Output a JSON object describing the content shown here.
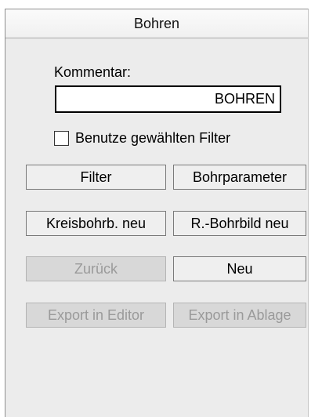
{
  "panel": {
    "title": "Bohren"
  },
  "comment": {
    "label": "Kommentar:",
    "value": "BOHREN"
  },
  "filter_option": {
    "label": "Benutze gewählten Filter",
    "checked": false
  },
  "buttons": {
    "filter": {
      "label": "Filter",
      "enabled": true
    },
    "drill_parameters": {
      "label": "Bohrparameter",
      "enabled": true
    },
    "new_circular_drill": {
      "label": "Kreisbohrb. neu",
      "enabled": true
    },
    "new_rect_drill_pattern": {
      "label": "R.-Bohrbild neu",
      "enabled": true
    },
    "back": {
      "label": "Zurück",
      "enabled": false
    },
    "new": {
      "label": "Neu",
      "enabled": true
    },
    "export_editor": {
      "label": "Export in Editor",
      "enabled": false
    },
    "export_clipboard": {
      "label": "Export in Ablage",
      "enabled": false
    }
  }
}
